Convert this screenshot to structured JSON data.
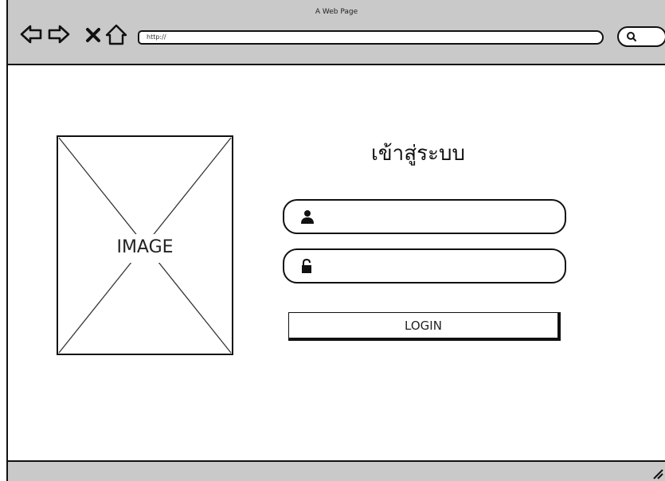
{
  "browser": {
    "title": "A Web Page",
    "url": "http://",
    "nav": {
      "back_icon": "back-arrow-icon",
      "forward_icon": "forward-arrow-icon",
      "stop_icon": "close-icon",
      "home_icon": "home-icon"
    },
    "search_icon": "search-icon"
  },
  "image_placeholder": {
    "label": "IMAGE"
  },
  "login": {
    "title": "เข้าสู่ระบบ",
    "username_icon": "user-icon",
    "password_icon": "unlock-icon",
    "button_label": "LOGIN"
  }
}
